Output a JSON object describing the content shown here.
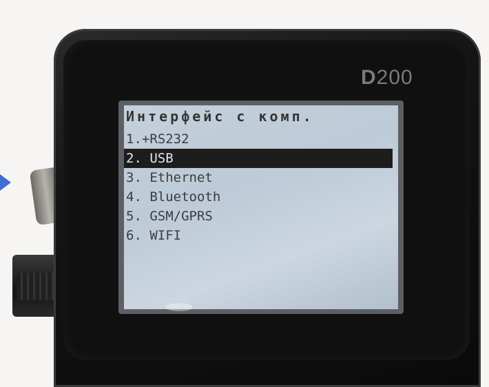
{
  "device": {
    "brand_prefix": "D",
    "brand_suffix": "200"
  },
  "screen": {
    "title": "Интерфейс с комп.",
    "menu": [
      {
        "label": "1.+RS232",
        "selected": false
      },
      {
        "label": "2. USB",
        "selected": true
      },
      {
        "label": "3. Ethernet",
        "selected": false
      },
      {
        "label": "4. Bluetooth",
        "selected": false
      },
      {
        "label": "5. GSM/GPRS",
        "selected": false
      },
      {
        "label": "6. WIFI",
        "selected": false
      }
    ]
  },
  "colors": {
    "selection_bg": "#1d1d1d",
    "lcd_bg": "#c4d0db",
    "arrow": "#3d6fd6"
  }
}
